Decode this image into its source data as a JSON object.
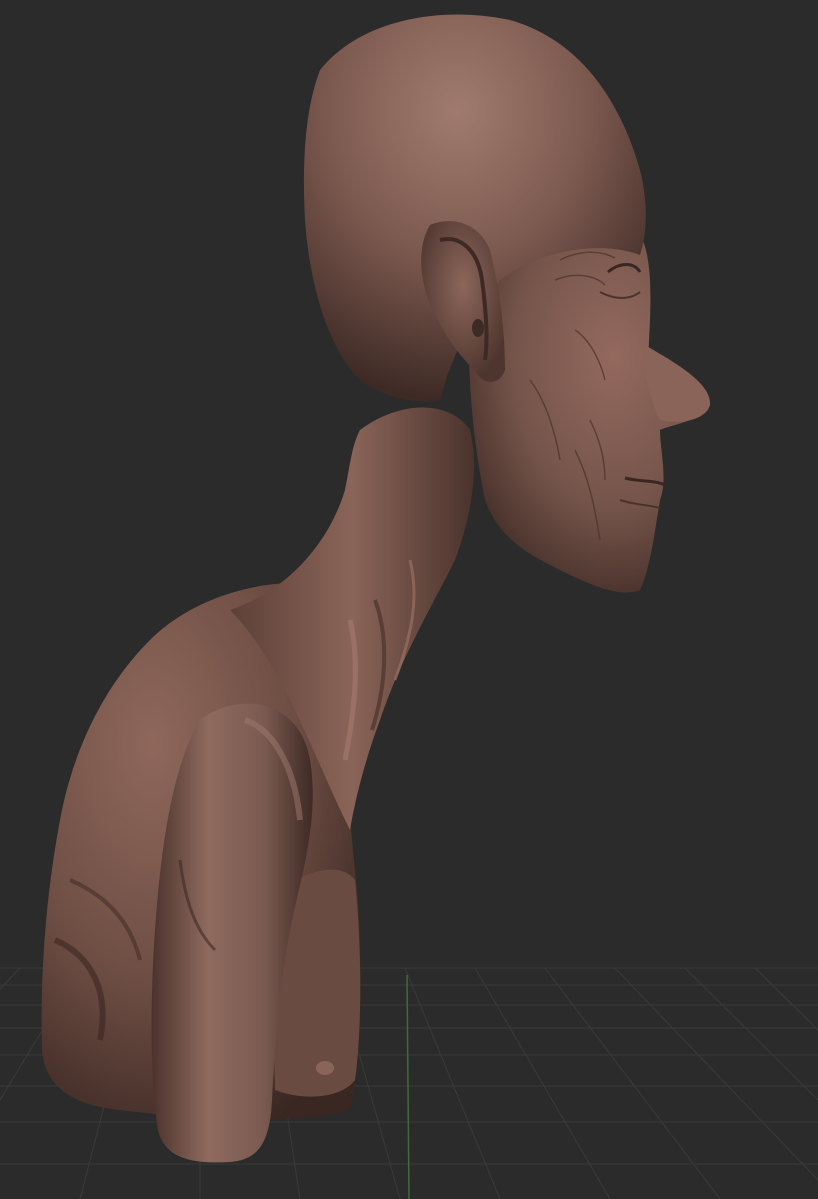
{
  "viewport": {
    "background_color": "#2b2b2b",
    "grid_color": "#3a3a3a",
    "axis_color": "#3f6b3f",
    "model_color": "#7d5a50",
    "model_highlight_color": "#9a7468",
    "model_shadow_color": "#3e2a25"
  },
  "model": {
    "icon": "sculpt-bust-figure"
  }
}
